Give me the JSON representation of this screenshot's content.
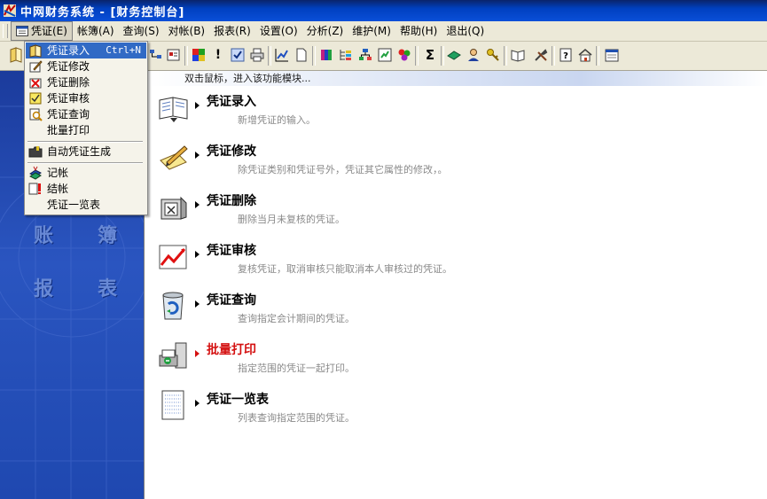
{
  "window": {
    "title": "中网财务系统 - [财务控制台]"
  },
  "menubar": {
    "items": [
      {
        "label": "凭证(E)"
      },
      {
        "label": "帐簿(A)"
      },
      {
        "label": "查询(S)"
      },
      {
        "label": "对帐(B)"
      },
      {
        "label": "报表(R)"
      },
      {
        "label": "设置(O)"
      },
      {
        "label": "分析(Z)"
      },
      {
        "label": "维护(M)"
      },
      {
        "label": "帮助(H)"
      },
      {
        "label": "退出(Q)"
      }
    ]
  },
  "dropdown": {
    "items": [
      {
        "label": "凭证录入",
        "shortcut": "Ctrl+N",
        "icon": "voucher-entry-icon"
      },
      {
        "label": "凭证修改",
        "icon": "voucher-edit-icon"
      },
      {
        "label": "凭证删除",
        "icon": "voucher-delete-icon"
      },
      {
        "label": "凭证审核",
        "icon": "voucher-audit-icon"
      },
      {
        "label": "凭证查询",
        "icon": "voucher-search-icon"
      },
      {
        "label": "批量打印"
      },
      {
        "label": "自动凭证生成",
        "icon": "folder-icon"
      },
      {
        "label": "记帐",
        "icon": "post-icon"
      },
      {
        "label": "结帐",
        "icon": "close-account-icon"
      },
      {
        "label": "凭证一览表"
      }
    ]
  },
  "hint": {
    "text": "双击鼠标，进入该功能模块..."
  },
  "leftpanel": {
    "glyphs": [
      "账",
      "簿",
      "报",
      "表"
    ]
  },
  "modules": [
    {
      "title": "凭证录入",
      "desc": "新增凭证的输入。",
      "icon": "book-icon"
    },
    {
      "title": "凭证修改",
      "desc": "除凭证类别和凭证号外，凭证其它属性的修改，。",
      "icon": "pencil-note-icon"
    },
    {
      "title": "凭证删除",
      "desc": "删除当月未复核的凭证。",
      "icon": "delete-doc-icon"
    },
    {
      "title": "凭证审核",
      "desc": "复核凭证，取消审核只能取消本人审核过的凭证。",
      "icon": "chart-trend-icon"
    },
    {
      "title": "凭证查询",
      "desc": "查询指定会计期间的凭证。",
      "icon": "recycle-bin-icon"
    },
    {
      "title": "批量打印",
      "desc": "指定范围的凭证一起打印。",
      "icon": "printer-icon"
    },
    {
      "title": "凭证一览表",
      "desc": "列表查询指定范围的凭证。",
      "icon": "list-doc-icon"
    }
  ],
  "toolbar": {
    "sigma": "Σ",
    "bang": "!"
  },
  "colors": {
    "highlight": "#316ac5",
    "titlebar": "#0a246a",
    "panel": "#1f48b0",
    "active_title": "#d41010"
  }
}
